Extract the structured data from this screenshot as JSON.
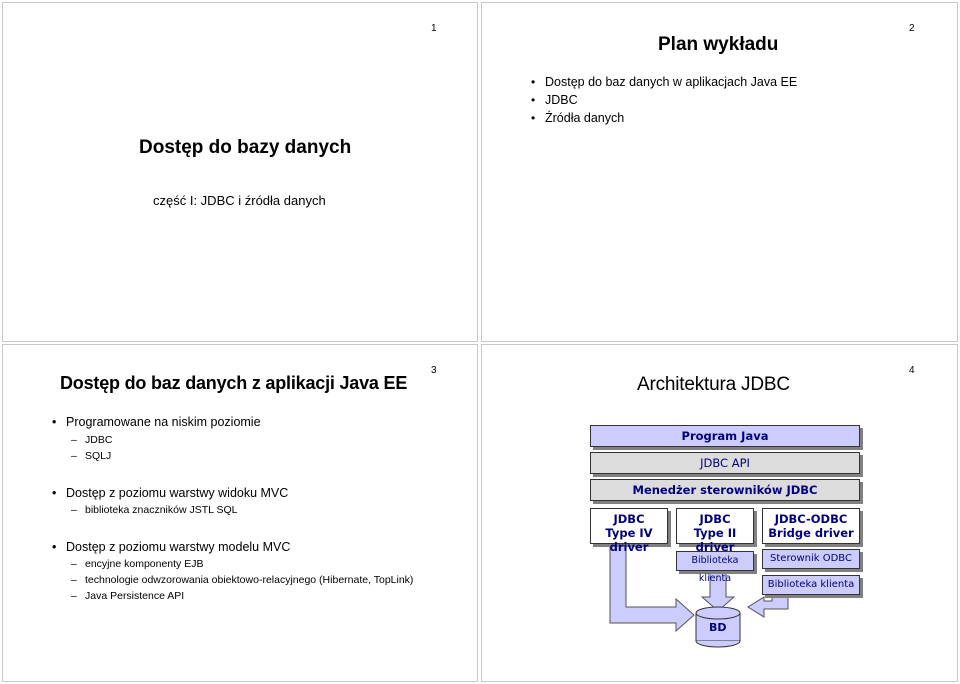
{
  "slide1": {
    "page_number": "1",
    "title": "Dostęp do bazy danych",
    "subtitle": "część I: JDBC i źródła danych"
  },
  "slide2": {
    "page_number": "2",
    "title": "Plan wykładu",
    "bullets": [
      "Dostęp do baz danych w aplikacjach Java EE",
      "JDBC",
      "Źródła danych"
    ]
  },
  "slide3": {
    "page_number": "3",
    "title": "Dostęp do baz danych z aplikacji Java EE",
    "groups": [
      {
        "label": "Programowane na niskim poziomie",
        "items": [
          "JDBC",
          "SQLJ"
        ]
      },
      {
        "label": "Dostęp z poziomu warstwy widoku MVC",
        "items": [
          "biblioteka znaczników JSTL SQL"
        ]
      },
      {
        "label": "Dostęp z poziomu warstwy modelu MVC",
        "items": [
          "encyjne komponenty EJB",
          "technologie odwzorowania obiektowo-relacyjnego (Hibernate, TopLink)",
          "Java Persistence API"
        ]
      }
    ]
  },
  "slide4": {
    "page_number": "4",
    "title": "Architektura JDBC",
    "diagram": {
      "program_java": "Program Java",
      "jdbc_api": "JDBC API",
      "manager": "Menedżer sterowników JDBC",
      "driver_type4_line1": "JDBC",
      "driver_type4_line2": "Type IV driver",
      "driver_type2_line1": "JDBC",
      "driver_type2_line2": "Type II driver",
      "bridge_line1": "JDBC-ODBC",
      "bridge_line2": "Bridge driver",
      "client_lib_1": "Biblioteka klienta",
      "odbc_driver": "Sterownik ODBC",
      "client_lib_2": "Biblioteka klienta",
      "database": "BD"
    },
    "colors": {
      "box_violet": "#ccccff",
      "box_grey": "#dcdcdc",
      "arrow_violet": "#ccccff",
      "text_navy": "#000080"
    }
  }
}
